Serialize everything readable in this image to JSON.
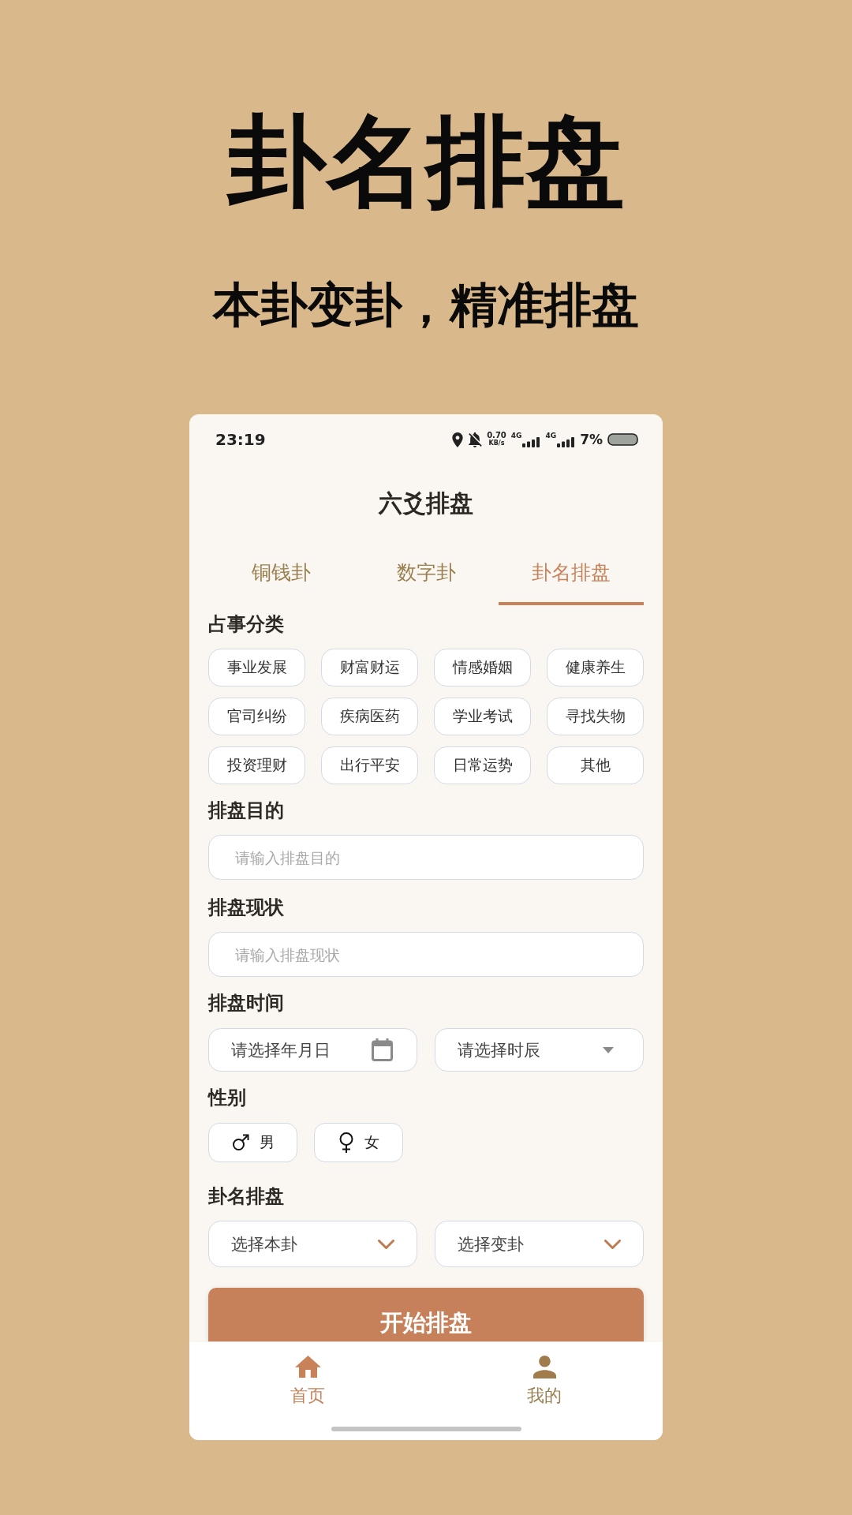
{
  "promo": {
    "title": "卦名排盘",
    "subtitle": "本卦变卦，精准排盘"
  },
  "status_bar": {
    "time": "23:19",
    "net_speed": "0.70",
    "net_speed_unit": "KB/s",
    "networks": [
      "4G",
      "4G"
    ],
    "battery": "7%"
  },
  "header": {
    "title": "六爻排盘"
  },
  "tabs": [
    {
      "label": "铜钱卦",
      "selected": false
    },
    {
      "label": "数字卦",
      "selected": false
    },
    {
      "label": "卦名排盘",
      "selected": true
    }
  ],
  "form": {
    "category": {
      "label": "占事分类",
      "options": [
        {
          "label": "事业发展",
          "selected": false
        },
        {
          "label": "财富财运",
          "selected": false
        },
        {
          "label": "情感婚姻",
          "selected": false
        },
        {
          "label": "健康养生",
          "selected": false
        },
        {
          "label": "官司纠纷",
          "selected": false
        },
        {
          "label": "疾病医药",
          "selected": false
        },
        {
          "label": "学业考试",
          "selected": false
        },
        {
          "label": "寻找失物",
          "selected": false
        },
        {
          "label": "投资理财",
          "selected": false
        },
        {
          "label": "出行平安",
          "selected": false
        },
        {
          "label": "日常运势",
          "selected": false
        },
        {
          "label": "其他",
          "selected": false
        }
      ]
    },
    "purpose": {
      "label": "排盘目的",
      "placeholder": "请输入排盘目的"
    },
    "situation": {
      "label": "排盘现状",
      "placeholder": "请输入排盘现状"
    },
    "time": {
      "label": "排盘时间",
      "date": {
        "placeholder": "请选择年月日"
      },
      "hour": {
        "placeholder": "请选择时辰"
      }
    },
    "gender": {
      "label": "性别",
      "options": [
        {
          "label": "男",
          "kind": "male",
          "selected": false
        },
        {
          "label": "女",
          "kind": "female",
          "selected": false
        }
      ]
    },
    "hexagram": {
      "label": "卦名排盘",
      "selects": [
        {
          "placeholder": "选择本卦"
        },
        {
          "placeholder": "选择变卦"
        }
      ]
    },
    "submit": "开始排盘"
  },
  "bottom_nav": [
    {
      "label": "首页",
      "kind": "home",
      "selected": true
    },
    {
      "label": "我的",
      "kind": "profile",
      "selected": false
    }
  ]
}
